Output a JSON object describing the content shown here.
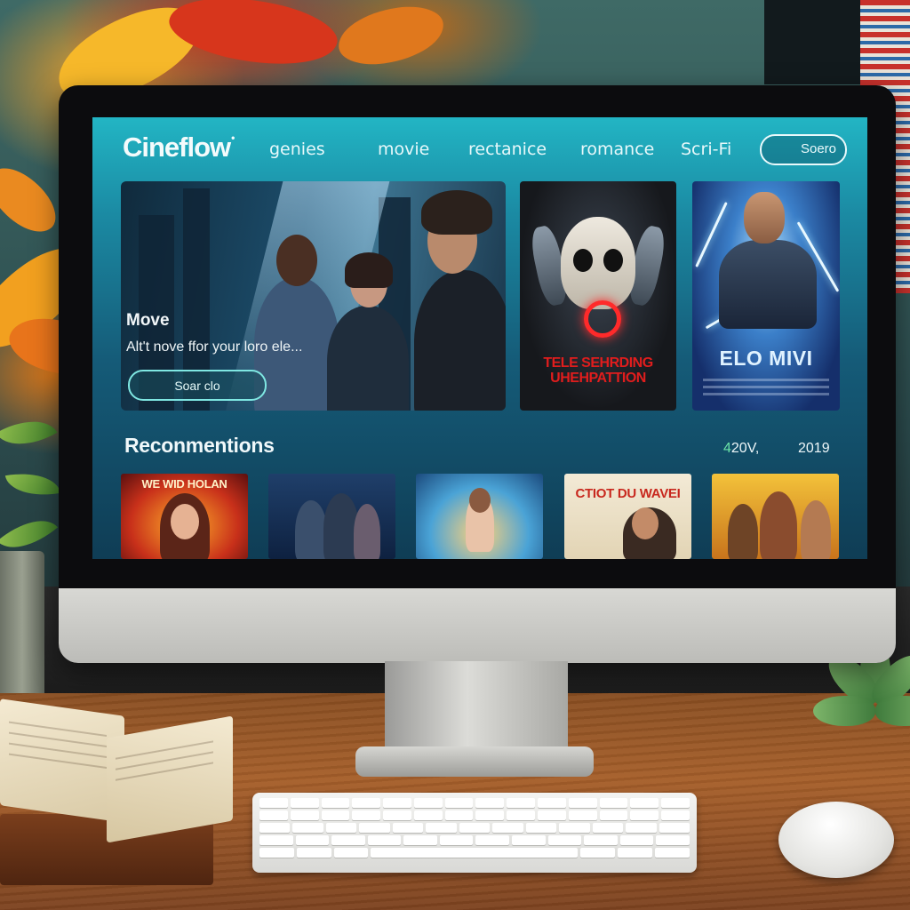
{
  "app": {
    "brand": "Cineflow",
    "brand_mark": "•"
  },
  "nav": {
    "links": [
      "genies",
      "movie",
      "rectanice",
      "romance",
      "Scri-Fi"
    ],
    "search_label": "Soero"
  },
  "hero": {
    "title": "Move",
    "subtitle": "Alt't nove ffor your loro ele...",
    "button_label": "Soar clo"
  },
  "featured_posters": [
    {
      "title": "TELE SEHRDING\nUHEHPATTION"
    },
    {
      "title": "ELO MIVI"
    }
  ],
  "recommendations": {
    "title": "Reconmentions",
    "meta_accent": "4",
    "meta": "20V,",
    "year": "2019",
    "items": [
      {
        "caption": "WE WID HOLAN"
      },
      {
        "caption": ""
      },
      {
        "caption": ""
      },
      {
        "caption": "CTIOT DU WAVEI"
      },
      {
        "caption": ""
      }
    ]
  },
  "colors": {
    "screen_top": "#22b5c4",
    "screen_bottom": "#0f3d55",
    "accent_ring": "#7fe7e2",
    "horror_red": "#e11d1d"
  }
}
